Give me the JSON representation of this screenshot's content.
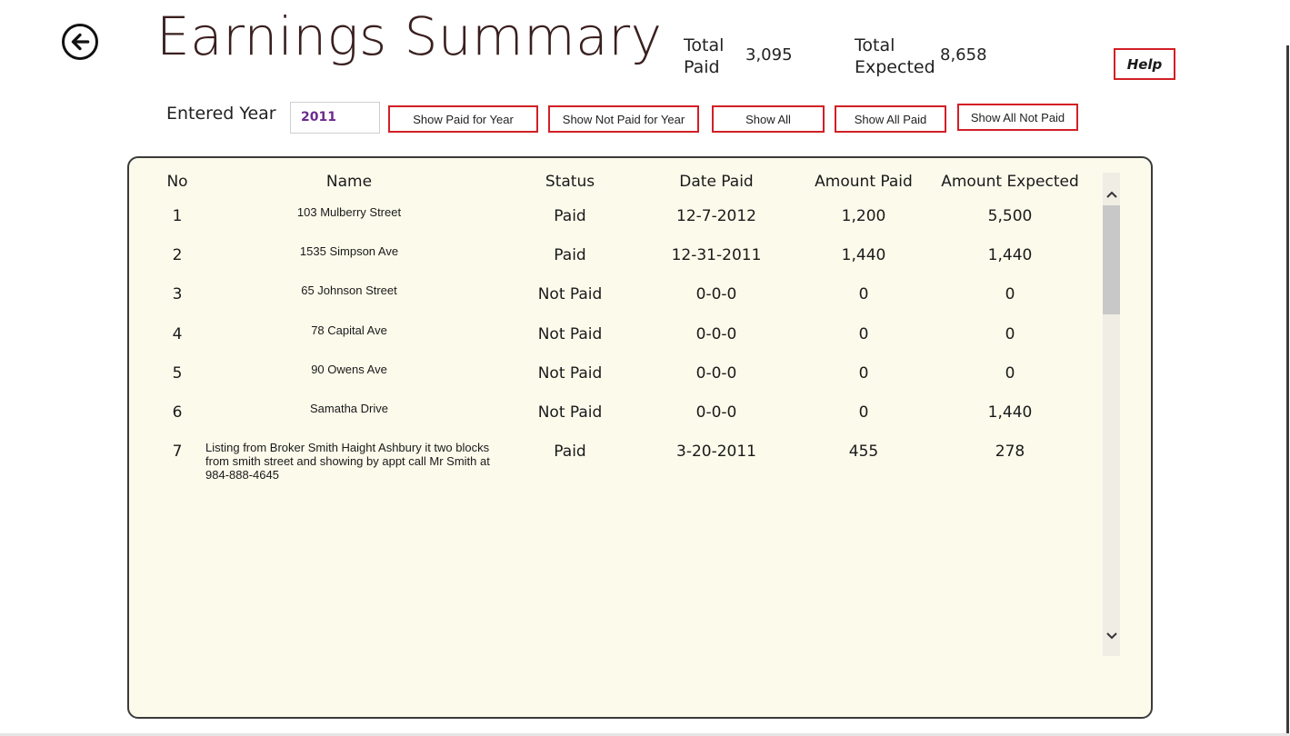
{
  "header": {
    "title": "Earnings Summary",
    "total_paid_label_line1": "Total",
    "total_paid_label_line2": "Paid",
    "total_paid_value": "3,095",
    "total_expected_label_line1": "Total",
    "total_expected_label_line2": "Expected",
    "total_expected_value": "8,658",
    "help_label": "Help"
  },
  "filters": {
    "year_label": "Entered Year",
    "year_value": "2011",
    "buttons": [
      "Show Paid for Year",
      "Show Not Paid for Year",
      "Show All",
      "Show All Paid",
      "Show All Not Paid"
    ]
  },
  "table": {
    "columns": [
      "No",
      "Name",
      "Status",
      "Date Paid",
      "Amount Paid",
      "Amount Expected"
    ],
    "rows": [
      {
        "no": "1",
        "name": "103 Mulberry Street",
        "status": "Paid",
        "date_paid": "12-7-2012",
        "amount_paid": "1,200",
        "amount_expected": "5,500"
      },
      {
        "no": "2",
        "name": "1535 Simpson Ave",
        "status": "Paid",
        "date_paid": "12-31-2011",
        "amount_paid": "1,440",
        "amount_expected": "1,440"
      },
      {
        "no": "3",
        "name": "65 Johnson Street",
        "status": "Not Paid",
        "date_paid": "0-0-0",
        "amount_paid": "0",
        "amount_expected": "0"
      },
      {
        "no": "4",
        "name": "78 Capital Ave",
        "status": "Not Paid",
        "date_paid": "0-0-0",
        "amount_paid": "0",
        "amount_expected": "0"
      },
      {
        "no": "5",
        "name": "90 Owens Ave",
        "status": "Not Paid",
        "date_paid": "0-0-0",
        "amount_paid": "0",
        "amount_expected": "0"
      },
      {
        "no": "6",
        "name": "Samatha Drive",
        "status": "Not Paid",
        "date_paid": "0-0-0",
        "amount_paid": "0",
        "amount_expected": "1,440"
      },
      {
        "no": "7",
        "name": "Listing from Broker Smith Haight Ashbury it two blocks from smith street and showing by appt call Mr Smith at 984-888-4645",
        "status": "Paid",
        "date_paid": "3-20-2011",
        "amount_paid": "455",
        "amount_expected": "278"
      }
    ]
  },
  "icons": {
    "back": "arrow-left-icon",
    "scroll_up": "chevron-up-icon",
    "scroll_down": "chevron-down-icon"
  },
  "colors": {
    "accent_border": "#d21f26",
    "panel_background": "#fbfaeb",
    "year_text": "#6b2a8e",
    "title_color": "#3a1f1f"
  }
}
